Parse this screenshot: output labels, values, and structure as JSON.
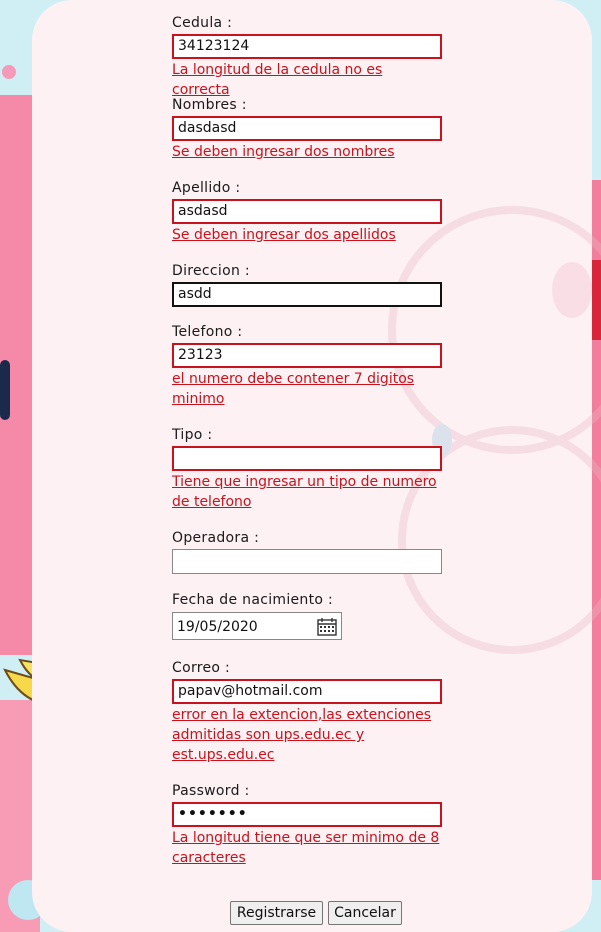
{
  "form": {
    "cedula": {
      "label": "Cedula :",
      "value": "34123124",
      "error": "La longitud de la cedula no es correcta"
    },
    "nombres": {
      "label": "Nombres :",
      "value": "dasdasd",
      "error": "Se deben ingresar dos nombres"
    },
    "apellido": {
      "label": "Apellido :",
      "value": "asdasd",
      "error": "Se deben ingresar dos apellidos"
    },
    "direccion": {
      "label": "Direccion :",
      "value": "asdd"
    },
    "telefono": {
      "label": "Telefono :",
      "value": "23123",
      "error_line1": "el numero debe contener 7 digitos",
      "error_line2": "minimo"
    },
    "tipo": {
      "label": "Tipo :",
      "value": "",
      "error_line1": "Tiene que ingresar un tipo de numero",
      "error_line2": "de telefono"
    },
    "operadora": {
      "label": "Operadora :",
      "value": ""
    },
    "fecha": {
      "label": "Fecha de nacimiento :",
      "value": "19/05/2020",
      "icon": "calendar-icon"
    },
    "correo": {
      "label": "Correo :",
      "value": "papav@hotmail.com",
      "error_line1": "error en la extencion,las extenciones",
      "error_line2": "admitidas son ups.edu.ec y",
      "error_line3": "est.ups.edu.ec"
    },
    "password": {
      "label": "Password :",
      "value": "•••••••",
      "error_line1": "La longitud tiene que ser minimo de 8",
      "error_line2": "caracteres"
    }
  },
  "buttons": {
    "register": "Registrarse",
    "cancel": "Cancelar"
  },
  "colors": {
    "error": "#c9121c",
    "panel": "#fdf1f4",
    "accent_pink": "#f58aa8"
  }
}
